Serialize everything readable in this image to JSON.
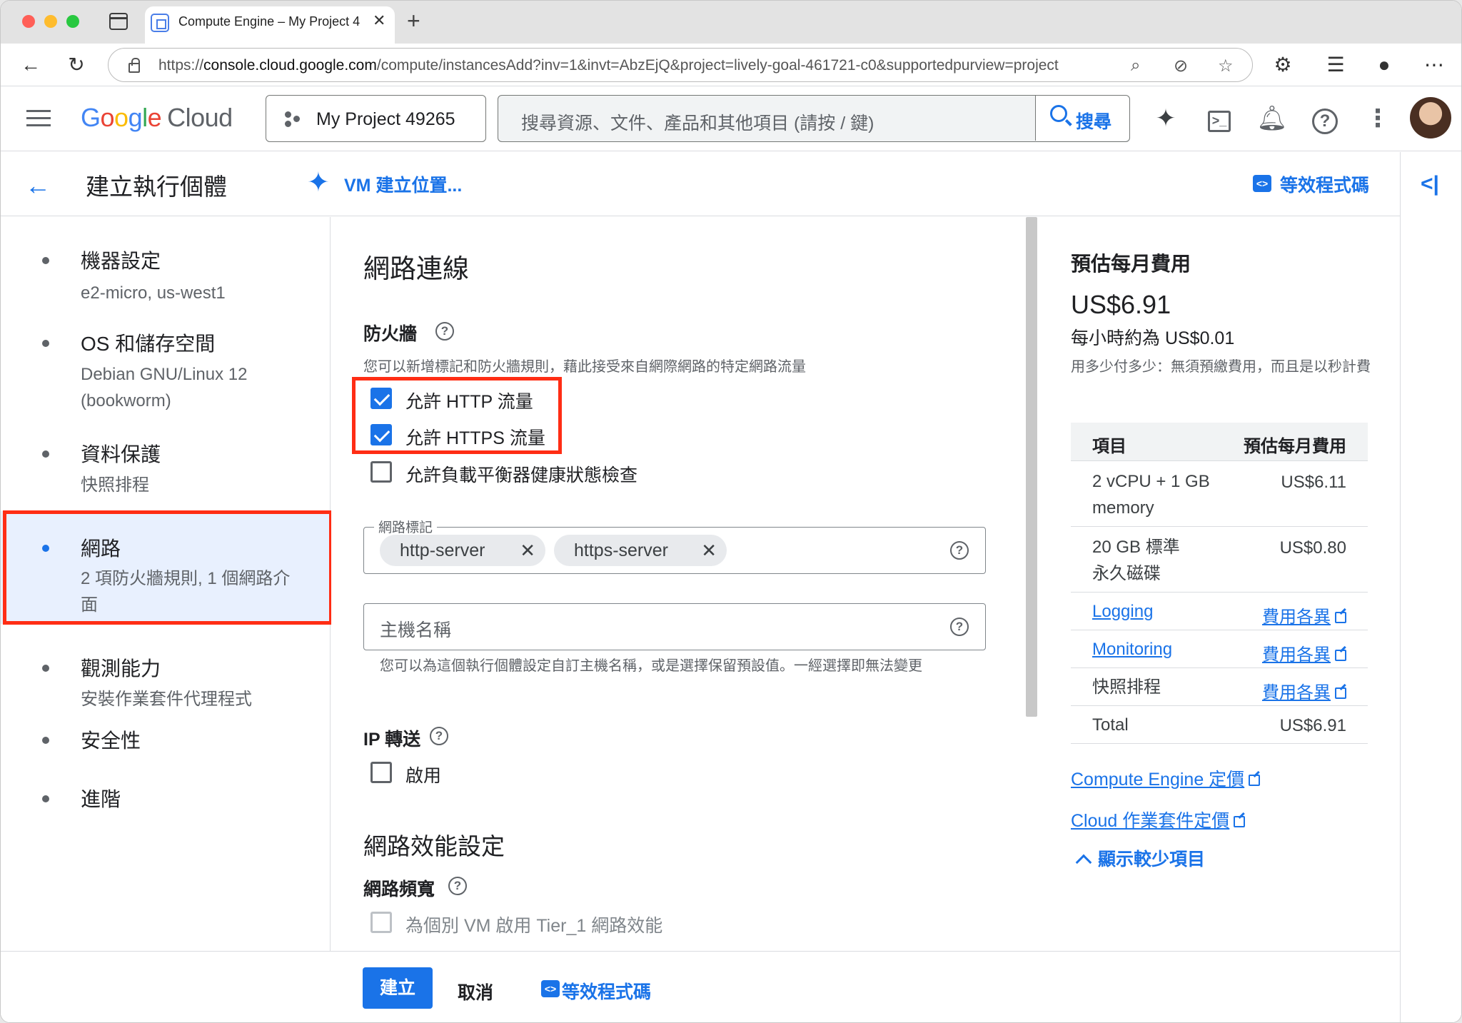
{
  "browser": {
    "tab_title": "Compute Engine – My Project 4",
    "url_prefix": "https://",
    "url_host": "console.cloud.google.com",
    "url_path": "/compute/instancesAdd?inv=1&invt=AbzEjQ&project=lively-goal-461721-c0&supportedpurview=project"
  },
  "header": {
    "logo_letters": [
      "G",
      "o",
      "o",
      "g",
      "l",
      "e"
    ],
    "logo_cloud": "Cloud",
    "project": "My Project 49265",
    "search_placeholder": "搜尋資源、文件、產品和其他項目 (請按 / 鍵)",
    "search_button": "搜尋"
  },
  "titlebar": {
    "title": "建立執行個體",
    "vm_link": "VM 建立位置...",
    "equiv_code": "等效程式碼"
  },
  "nav": [
    {
      "title": "機器設定",
      "sub": "e2-micro, us-west1"
    },
    {
      "title": "OS 和儲存空間",
      "sub": "Debian GNU/Linux 12 (bookworm)"
    },
    {
      "title": "資料保護",
      "sub": "快照排程"
    },
    {
      "title": "網路",
      "sub": "2 項防火牆規則, 1 個網路介面"
    },
    {
      "title": "觀測能力",
      "sub": "安裝作業套件代理程式"
    },
    {
      "title": "安全性",
      "sub": ""
    },
    {
      "title": "進階",
      "sub": ""
    }
  ],
  "form": {
    "section_title": "網路連線",
    "firewall_label": "防火牆",
    "firewall_hint": "您可以新增標記和防火牆規則，藉此接受來自網際網路的特定網路流量",
    "allow_http": "允許 HTTP 流量",
    "allow_https": "允許 HTTPS 流量",
    "allow_lb": "允許負載平衡器健康狀態檢查",
    "tags_legend": "網路標記",
    "tags": [
      "http-server",
      "https-server"
    ],
    "hostname_placeholder": "主機名稱",
    "hostname_hint": "您可以為這個執行個體設定自訂主機名稱，或是選擇保留預設值。一經選擇即無法變更",
    "ip_forward_label": "IP 轉送",
    "ip_forward_enable": "啟用",
    "perf_title": "網路效能設定",
    "bandwidth_label": "網路頻寬",
    "tier1": "為個別 VM 啟用 Tier_1 網路效能"
  },
  "cost": {
    "title": "預估每月費用",
    "monthly": "US$6.91",
    "hourly": "每小時約為 US$0.01",
    "note": "用多少付多少：無須預繳費用，而且是以秒計費",
    "col_item": "項目",
    "col_cost": "預估每月費用",
    "rows": [
      {
        "item": "2 vCPU + 1 GB memory",
        "value": "US$6.11"
      },
      {
        "item": "20 GB 標準永久磁碟",
        "value": "US$0.80"
      },
      {
        "item": "Logging",
        "value": "費用各異"
      },
      {
        "item": "Monitoring",
        "value": "費用各異"
      },
      {
        "item": "快照排程",
        "value": "費用各異"
      },
      {
        "item": "Total",
        "value": "US$6.91"
      }
    ],
    "link_ce": "Compute Engine 定價",
    "link_ops": "Cloud 作業套件定價",
    "show_less": "顯示較少項目"
  },
  "footer": {
    "create": "建立",
    "cancel": "取消",
    "equiv_code": "等效程式碼"
  },
  "colors": {
    "accent": "#1a73e8",
    "highlight_box": "#ff2d14",
    "active_nav_bg": "#e8f0fe"
  }
}
